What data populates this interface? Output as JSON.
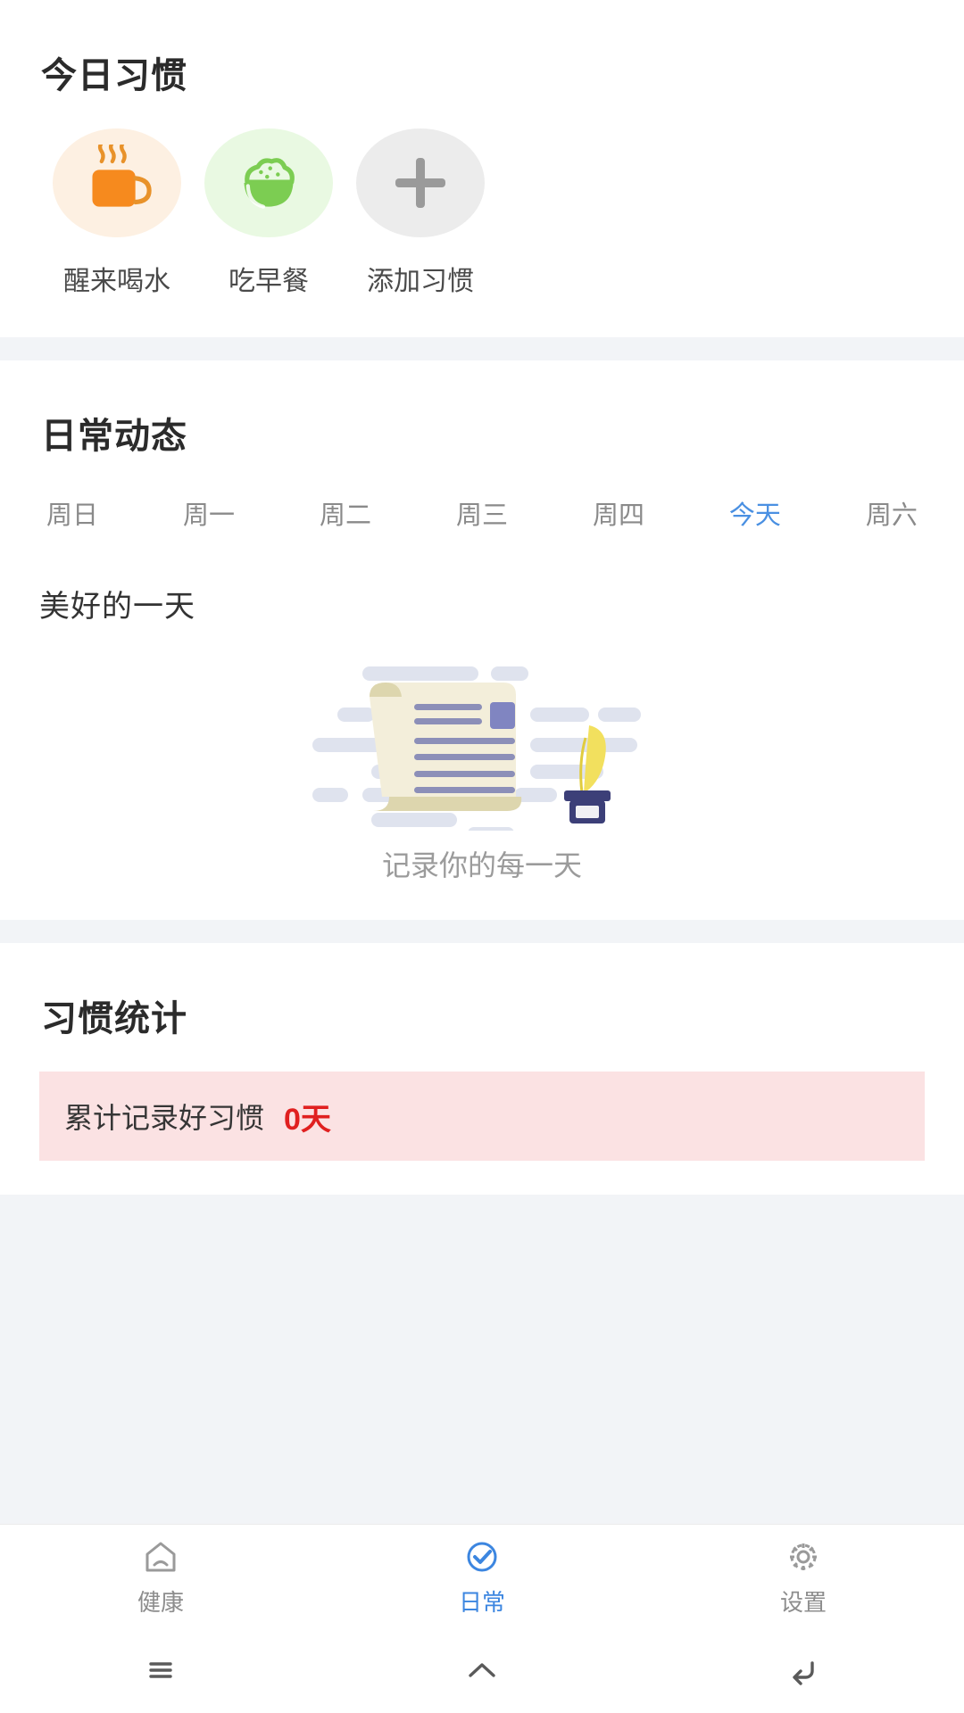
{
  "today_habits": {
    "title": "今日习惯",
    "items": [
      {
        "label": "醒来喝水",
        "icon": "coffee-cup-icon",
        "bg": "#fdf0e2",
        "color": "#f68a1e"
      },
      {
        "label": "吃早餐",
        "icon": "rice-bowl-icon",
        "bg": "#e9f9e2",
        "color": "#7ccd52"
      },
      {
        "label": "添加习惯",
        "icon": "plus-icon",
        "bg": "#ececec",
        "color": "#9a9a9a"
      }
    ]
  },
  "daily_dynamic": {
    "title": "日常动态",
    "weekdays": [
      {
        "label": "周日",
        "active": false
      },
      {
        "label": "周一",
        "active": false
      },
      {
        "label": "周二",
        "active": false
      },
      {
        "label": "周三",
        "active": false
      },
      {
        "label": "周四",
        "active": false
      },
      {
        "label": "今天",
        "active": true
      },
      {
        "label": "周六",
        "active": false
      }
    ],
    "entry_title": "美好的一天",
    "empty_caption": "记录你的每一天",
    "empty_illustration": "scroll-and-quill-illustration"
  },
  "habit_stats": {
    "title": "习惯统计",
    "banner_label": "累计记录好习惯",
    "banner_value": "0天"
  },
  "tabbar": {
    "items": [
      {
        "label": "健康",
        "icon": "home-house-icon",
        "active": false
      },
      {
        "label": "日常",
        "icon": "check-circle-icon",
        "active": true
      },
      {
        "label": "设置",
        "icon": "gear-icon",
        "active": false
      }
    ]
  },
  "system_nav": {
    "items": [
      {
        "icon": "menu-recents-icon"
      },
      {
        "icon": "home-icon"
      },
      {
        "icon": "back-icon"
      }
    ]
  },
  "colors": {
    "accent": "#4a90e2",
    "danger": "#e02020",
    "page_bg": "#f2f4f7",
    "card_bg": "#ffffff"
  }
}
